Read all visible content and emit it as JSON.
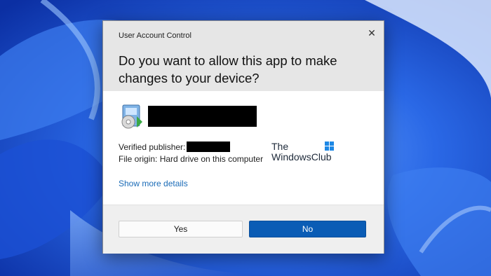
{
  "dialog": {
    "window_title": "User Account Control",
    "question": "Do you want to allow this app to make changes to your device?",
    "close_icon": "close-icon",
    "app_icon": "installer-icon",
    "details": {
      "publisher_label": "Verified publisher:",
      "origin_text": "File origin: Hard drive on this computer"
    },
    "watermark": {
      "line1": "The",
      "line2": "WindowsClub"
    },
    "show_more_label": "Show more details",
    "buttons": {
      "yes_label": "Yes",
      "no_label": "No"
    }
  },
  "colors": {
    "accent": "#0a5cb5",
    "link": "#1a6bb7",
    "header_bg": "#e6e6e6",
    "footer_bg": "#efefef",
    "wallpaper": "#1f57d6"
  }
}
